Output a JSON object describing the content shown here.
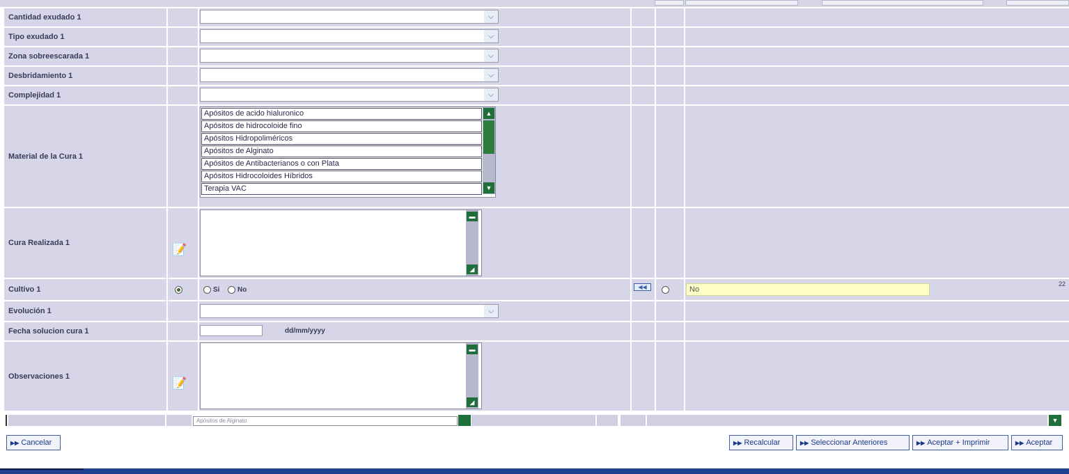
{
  "rows": {
    "cantidad_exudado": {
      "label": "Cantidad exudado 1"
    },
    "tipo_exudado": {
      "label": "Tipo exudado 1"
    },
    "zona_sobreescarada": {
      "label": "Zona sobreescarada 1"
    },
    "desbridamiento": {
      "label": "Desbridamiento 1"
    },
    "complejidad": {
      "label": "Complejidad 1"
    },
    "material_cura": {
      "label": "Material de la Cura 1",
      "options": [
        "Apósitos de acido hialuronico",
        "Apósitos de hidrocoloide fino",
        "Apósitos Hidropoliméricos",
        "Apósitos de Alginato",
        "Apósitos de Antibacterianos o con Plata",
        "Apósitos Hidrocoloides Híbridos",
        "Terapia VAC"
      ]
    },
    "cura_realizada": {
      "label": "Cura Realizada 1"
    },
    "cultivo": {
      "label": "Cultivo 1",
      "option_si": "Si",
      "option_no": "No",
      "previous_value": "No",
      "edge_value": "22"
    },
    "evolucion": {
      "label": "Evolución 1"
    },
    "fecha_solucion": {
      "label": "Fecha solucion cura 1",
      "format_hint": "dd/mm/yyyy"
    },
    "observaciones": {
      "label": "Observaciones 1"
    }
  },
  "partial_row": {
    "text": "Apósitos de Alginato"
  },
  "buttons": {
    "cancelar": "Cancelar",
    "recalcular": "Recalcular",
    "seleccionar_anteriores": "Seleccionar Anteriores",
    "aceptar_imprimir": "Aceptar + Imprimir",
    "aceptar": "Aceptar"
  },
  "colors": {
    "row_background": "#d6d6e8",
    "button_text": "#1a3a8a",
    "scrollbar_green": "#1f6f3a",
    "previous_value_background": "#ffffc8",
    "bottom_bar": "#1f3f8f"
  }
}
